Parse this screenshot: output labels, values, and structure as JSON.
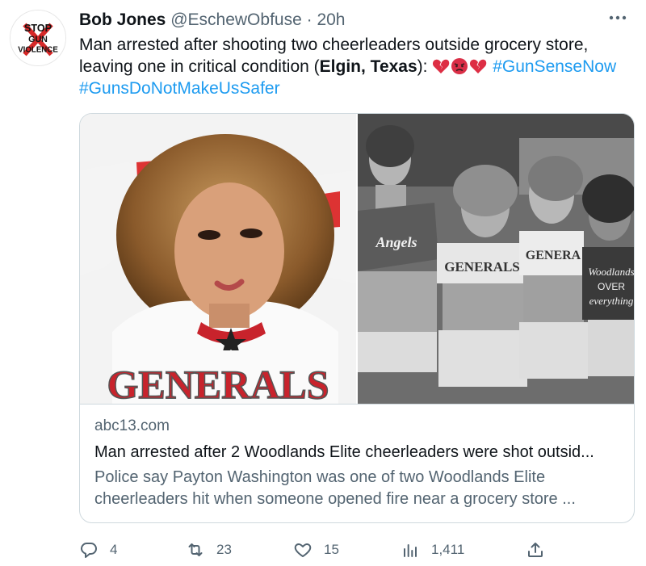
{
  "author": {
    "name": "Bob Jones",
    "handle": "@EschewObfuse",
    "separator": "·",
    "time": "20h",
    "avatar_text": [
      "STOP",
      "GUN",
      "VIOLENCE"
    ]
  },
  "tweet": {
    "line1": "Man arrested after shooting two cheerleaders outside grocery store,",
    "line2_prefix": "leaving one in critical condition (",
    "location": "Elgin, Texas",
    "line2_suffix": "):",
    "emojis": [
      "broken-heart-icon",
      "angry-face-icon",
      "broken-heart-icon"
    ],
    "hashtag1": "#GunSenseNow",
    "hashtag2": "#GunsDoNotMakeUsSafer"
  },
  "card": {
    "domain": "abc13.com",
    "title": "Man arrested after 2 Woodlands Elite cheerleaders were shot outsid...",
    "description": "Police say Payton Washington was one of two Woodlands Elite cheerleaders hit when someone opened fire near a grocery store ...",
    "image_left_text": "GENERALS",
    "image_right_texts": [
      "Angels",
      "GENERALS",
      "GENERA",
      "Woodlands",
      "OVER",
      "everything"
    ]
  },
  "actions": {
    "replies": "4",
    "retweets": "23",
    "likes": "15",
    "views": "1,411"
  },
  "colors": {
    "accent": "#1d9bf0",
    "secondary_text": "#536471",
    "border": "#cfd9de"
  }
}
